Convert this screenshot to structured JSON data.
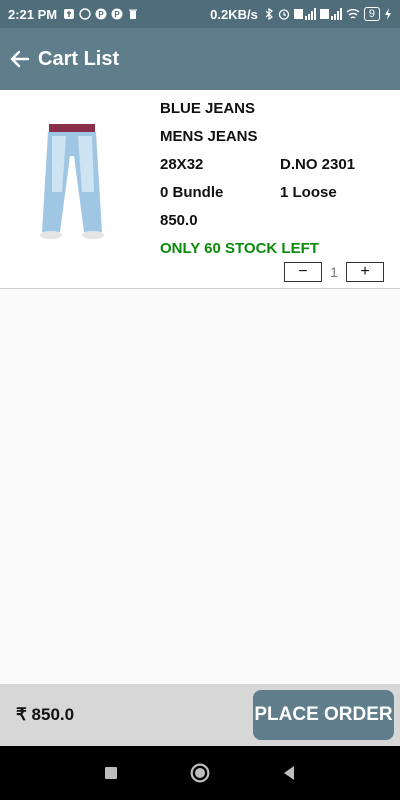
{
  "statusbar": {
    "time": "2:21 PM",
    "net_speed": "0.2KB/s",
    "battery": "9"
  },
  "appbar": {
    "title": "Cart List"
  },
  "item": {
    "name": "BLUE JEANS",
    "category": "MENS JEANS",
    "size": "28X32",
    "design_no": "D.NO 2301",
    "bundle": "0 Bundle",
    "loose": "1 Loose",
    "price": "850.0",
    "stock": "ONLY 60 STOCK LEFT",
    "quantity": "1",
    "decrement_label": "−",
    "increment_label": "+"
  },
  "footer": {
    "total": "₹ 850.0",
    "place_order_label": "PLACE ORDER"
  },
  "colors": {
    "appbar": "#607d8b",
    "statusbar": "#4f6d7a",
    "stock_green": "#0a8a0a",
    "footer_bg": "#d7d7d7"
  }
}
